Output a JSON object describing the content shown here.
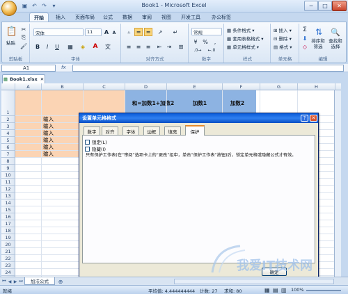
{
  "window": {
    "title": "Book1 - Microsoft Excel",
    "min": "−",
    "max": "□",
    "close": "✕"
  },
  "ribbon_tabs": [
    "开始",
    "插入",
    "页面布局",
    "公式",
    "数据",
    "审阅",
    "视图",
    "开发工具",
    "办公标签"
  ],
  "ribbon": {
    "paste": "粘贴",
    "clipboard": "剪贴板",
    "font_name": "宋体",
    "font_size": "11",
    "font_group": "字体",
    "align_group": "对齐方式",
    "number_format": "常规",
    "number_group": "数字",
    "cond_format": "条件格式",
    "table_format": "套用表格格式",
    "cell_style": "单元格样式",
    "style_group": "样式",
    "insert": "插入",
    "delete": "删除",
    "format": "格式",
    "cells_group": "单元格",
    "sort_filter": "排序和筛选",
    "find_select": "查找和选择",
    "edit_group": "编辑"
  },
  "formula_bar": {
    "name_box": "A1",
    "fx": "fx",
    "value": ""
  },
  "doc_tab": "Book1.xlsx",
  "columns": [
    "A",
    "B",
    "C",
    "D",
    "E",
    "F",
    "G",
    "H",
    "I",
    "J",
    "K"
  ],
  "rows": [
    "1",
    "2",
    "3",
    "4",
    "5",
    "6",
    "7",
    "8",
    "9",
    "10",
    "11",
    "12",
    "13",
    "14",
    "15",
    "16",
    "17",
    "18",
    "19",
    "20",
    "21",
    "22",
    "23",
    "24",
    "25"
  ],
  "cells": {
    "e1": "和=加数1+加数2",
    "f1": "加数1",
    "g1": "加数2",
    "b_inputs": [
      "输入",
      "输入",
      "输入",
      "输入",
      "输入",
      "输入"
    ]
  },
  "dialog": {
    "title": "设置单元格格式",
    "help": "?",
    "close": "✕",
    "tabs": [
      "数字",
      "对齐",
      "字体",
      "边框",
      "填充",
      "保护"
    ],
    "locked": "锁定(L)",
    "hidden": "隐藏(I)",
    "info": "只有保护工作表(在“审阅”选项卡上的“更改”组中，单击“保护工作表”按钮)后，锁定单元格或隐藏公式才有效。",
    "ok": "确定"
  },
  "sheet_tab": "加法公式",
  "status": {
    "ready": "就绪",
    "average": "平均值: 4.444444444",
    "count": "计数: 27",
    "sum": "求和: 80",
    "zoom": "100%"
  },
  "watermark": "我爱IT技术网"
}
